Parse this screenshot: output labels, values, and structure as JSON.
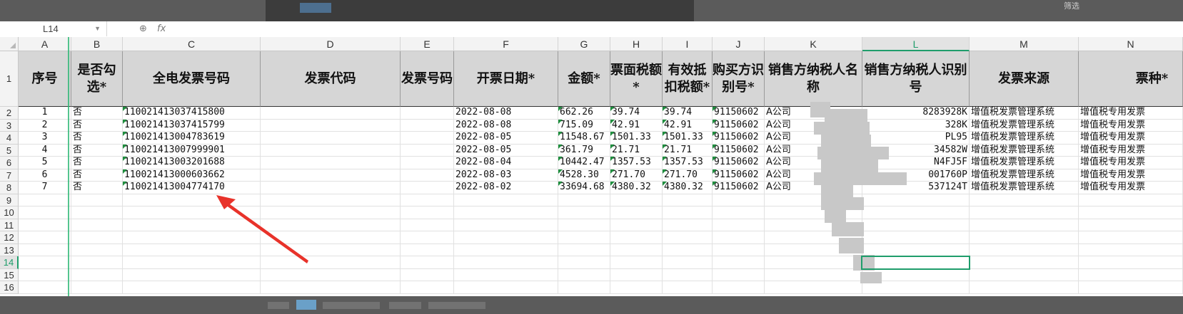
{
  "formula_bar": {
    "name_box": "L14",
    "fx_label": "fx"
  },
  "columns": [
    "A",
    "B",
    "C",
    "D",
    "E",
    "F",
    "G",
    "H",
    "I",
    "J",
    "K",
    "L",
    "M",
    "N"
  ],
  "selected_column": "L",
  "rows": [
    "1",
    "2",
    "3",
    "4",
    "5",
    "6",
    "7",
    "8",
    "9",
    "10",
    "11",
    "12",
    "13",
    "14",
    "15",
    "16"
  ],
  "selected_row": "14",
  "header_row": {
    "A": "序号",
    "B": "是否勾选*",
    "C": "全电发票号码",
    "D": "发票代码",
    "E": "发票号码",
    "F": "开票日期*",
    "G": "金额*",
    "H": "票面税额*",
    "I": "有效抵扣税额*",
    "J": "购买方识别号*",
    "K": "销售方纳税人名称",
    "L": "销售方纳税人识别号",
    "M": "发票来源",
    "N": "票种*"
  },
  "data_rows": [
    {
      "A": "1",
      "B": "否",
      "C": "110021413037415800",
      "F": "2022-08-08",
      "G": "662.26",
      "H": "39.74",
      "I": "39.74",
      "J": "91150602",
      "K": "A公司",
      "L": "8283928K",
      "M": "增值税发票管理系统",
      "N": "增值税专用发票"
    },
    {
      "A": "2",
      "B": "否",
      "C": "110021413037415799",
      "F": "2022-08-08",
      "G": "715.09",
      "H": "42.91",
      "I": "42.91",
      "J": "91150602",
      "K": "A公司",
      "L": "328K",
      "M": "增值税发票管理系统",
      "N": "增值税专用发票"
    },
    {
      "A": "3",
      "B": "否",
      "C": "110021413004783619",
      "F": "2022-08-05",
      "G": "11548.67",
      "H": "1501.33",
      "I": "1501.33",
      "J": "91150602",
      "K": "A公司",
      "L": "PL95",
      "M": "增值税发票管理系统",
      "N": "增值税专用发票"
    },
    {
      "A": "4",
      "B": "否",
      "C": "110021413007999901",
      "F": "2022-08-05",
      "G": "361.79",
      "H": "21.71",
      "I": "21.71",
      "J": "91150602",
      "K": "A公司",
      "L": "34582W",
      "M": "增值税发票管理系统",
      "N": "增值税专用发票"
    },
    {
      "A": "5",
      "B": "否",
      "C": "110021413003201688",
      "F": "2022-08-04",
      "G": "10442.47",
      "H": "1357.53",
      "I": "1357.53",
      "J": "91150602",
      "K": "A公司",
      "L": "N4FJ5F",
      "M": "增值税发票管理系统",
      "N": "增值税专用发票"
    },
    {
      "A": "6",
      "B": "否",
      "C": "110021413000603662",
      "F": "2022-08-03",
      "G": "4528.30",
      "H": "271.70",
      "I": "271.70",
      "J": "91150602",
      "K": "A公司",
      "L": "001760P",
      "M": "增值税发票管理系统",
      "N": "增值税专用发票"
    },
    {
      "A": "7",
      "B": "否",
      "C": "110021413004774170",
      "F": "2022-08-02",
      "G": "33694.68",
      "H": "4380.32",
      "I": "4380.32",
      "J": "91150602",
      "K": "A公司",
      "L": "537124T",
      "M": "增值税发票管理系统",
      "N": "增值税专用发票"
    }
  ],
  "top_hint": "筛选",
  "colors": {
    "selection": "#1f9d6b",
    "header_fill": "#d6d6d6",
    "arrow": "#e8322a"
  }
}
